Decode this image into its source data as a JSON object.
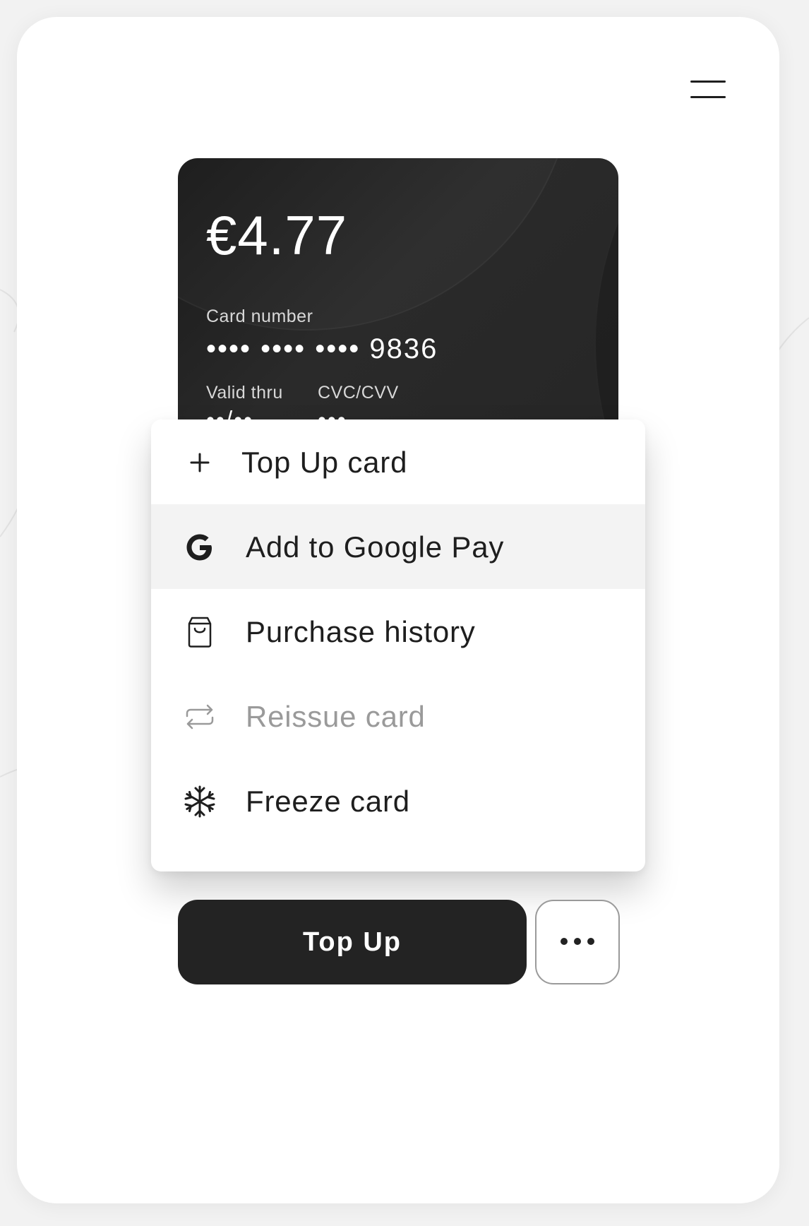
{
  "card": {
    "balance": "€4.77",
    "number_label": "Card number",
    "number_value": "•••• •••• •••• 9836",
    "valid_label": "Valid thru",
    "valid_value": "••/••",
    "cvc_label": "CVC/CVV",
    "cvc_value": "•••"
  },
  "menu": {
    "items": [
      {
        "label": "Top Up card",
        "icon": "plus-icon",
        "state": "normal"
      },
      {
        "label": "Add to Google Pay",
        "icon": "google-icon",
        "state": "highlighted"
      },
      {
        "label": "Purchase history",
        "icon": "shopping-bag-icon",
        "state": "normal"
      },
      {
        "label": "Reissue card",
        "icon": "repeat-icon",
        "state": "disabled"
      },
      {
        "label": "Freeze card",
        "icon": "snowflake-icon",
        "state": "normal"
      }
    ]
  },
  "actions": {
    "top_up_label": "Top Up",
    "more_icon": "more-dots-icon",
    "hamburger_icon": "hamburger-menu-icon"
  },
  "colors": {
    "card_bg": "#1e1e1e",
    "primary_button": "#232323",
    "highlight_row": "#f3f3f3",
    "disabled_text": "#9a9a9a",
    "text": "#1e1e1e"
  }
}
